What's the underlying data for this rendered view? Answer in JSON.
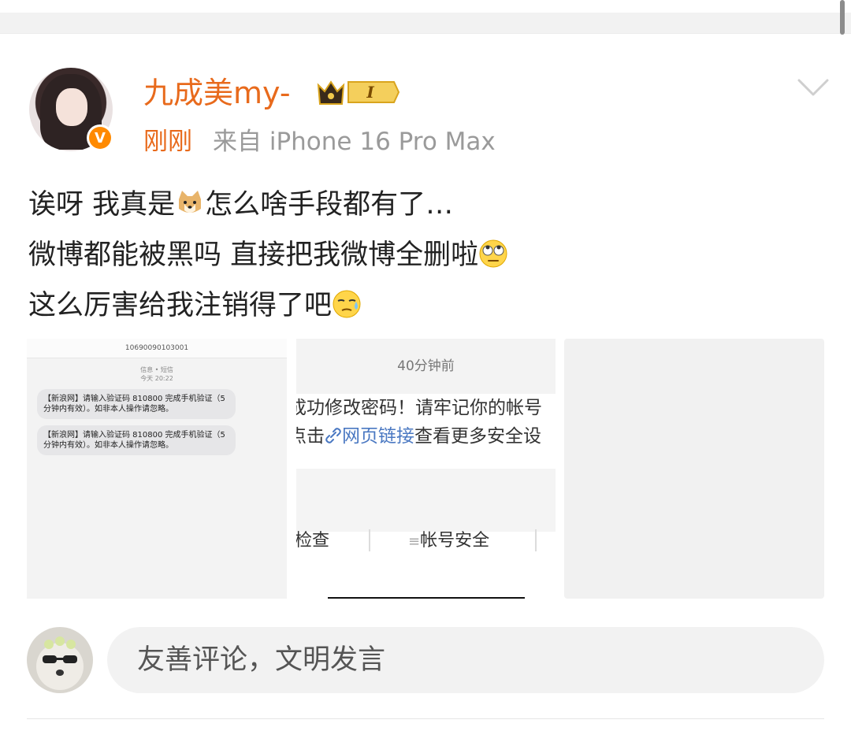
{
  "user": {
    "name": "九成美my-",
    "level_badge": "I",
    "verified_badge": "V"
  },
  "meta": {
    "time": "刚刚",
    "source": "来自 iPhone 16 Pro Max"
  },
  "post": {
    "line1_a": "诶呀 我真是",
    "line1_b": "怎么啥手段都有了…",
    "line2": "微博都能被黑吗 直接把我微博全删啦",
    "line3": "这么厉害给我注销得了吧"
  },
  "images": [
    {
      "sender": "10690090103001",
      "label": "信息 • 短信",
      "time": "今天 20:22",
      "messages": [
        "【新浪网】请输入验证码 810800 完成手机验证（5分钟内有效）。如非本人操作请忽略。",
        "【新浪网】请输入验证码 810800 完成手机验证（5分钟内有效）。如非本人操作请忽略。"
      ]
    },
    {
      "time": "40分钟前",
      "line1": "成功修改密码！请牢记你的帐号",
      "line2_a": "点击",
      "line2_link": "网页链接",
      "line2_b": "查看更多安全设",
      "button1": "检查",
      "button2": "帐号安全"
    },
    {}
  ],
  "comment": {
    "placeholder": "友善评论，文明发言"
  },
  "colors": {
    "accent": "#e86a1c",
    "badge": "#ff8a00",
    "link": "#4a78c2"
  },
  "icons": [
    "chevron-down-icon",
    "crown-level-icon",
    "verified-icon",
    "dog-emoji",
    "eye-roll-emoji",
    "sweat-emoji",
    "link-icon",
    "menu-icon"
  ]
}
